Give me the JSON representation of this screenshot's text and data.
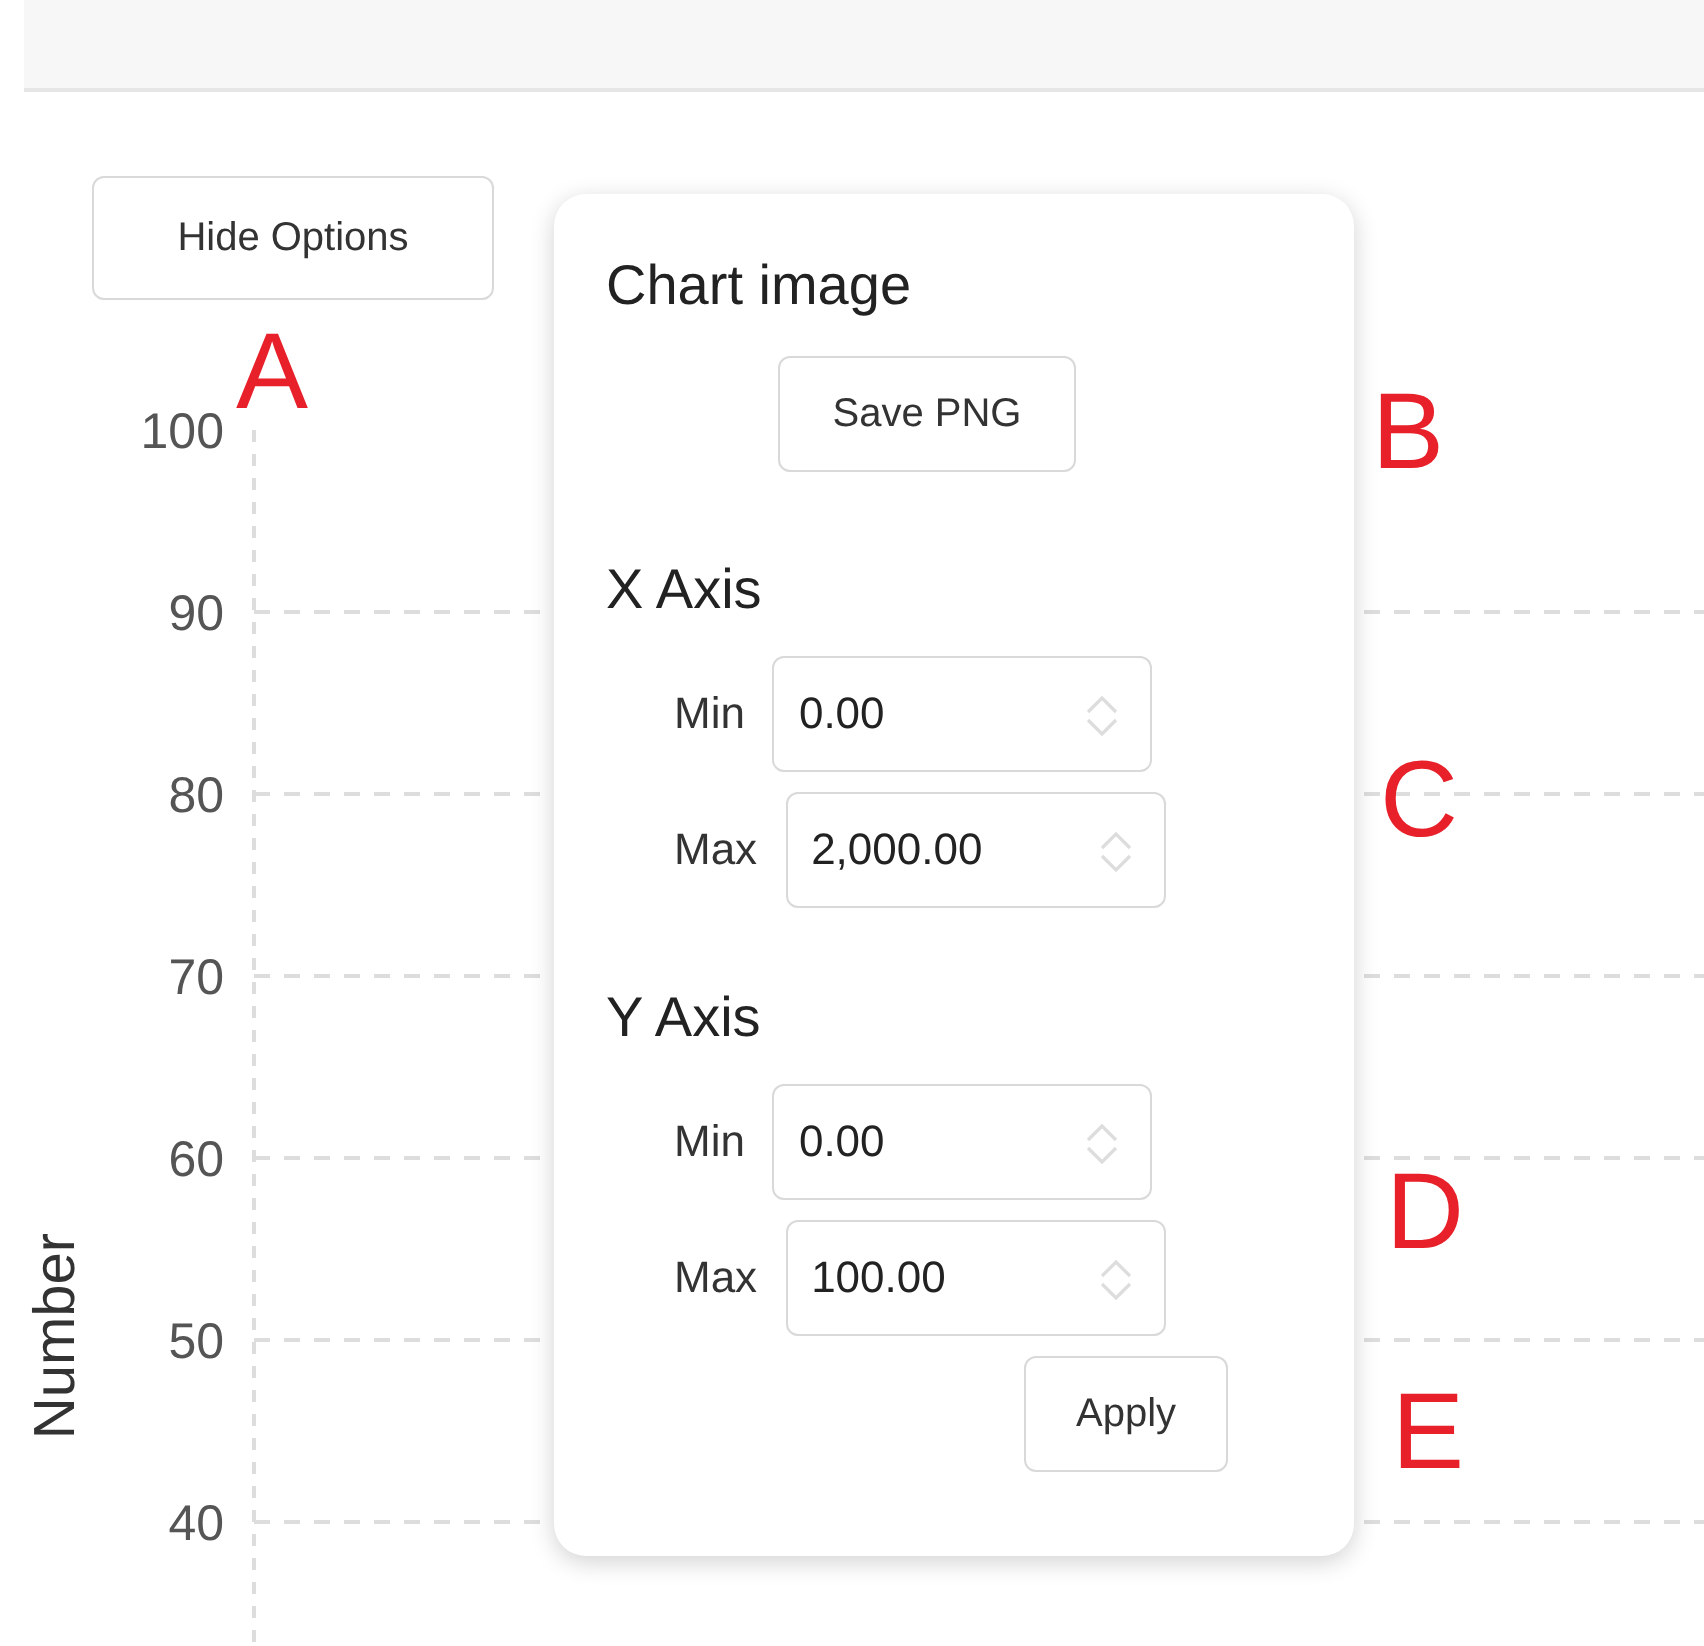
{
  "hide_options_button": "Hide Options",
  "chart": {
    "y_axis": {
      "title": "Number",
      "tick_labels": [
        "100",
        "90",
        "80",
        "70",
        "60",
        "50",
        "40"
      ]
    }
  },
  "options_panel": {
    "title": "Chart image",
    "save_button": "Save PNG",
    "axes": [
      {
        "title": "X Axis",
        "fields": [
          {
            "label": "Min",
            "value": "0.00"
          },
          {
            "label": "Max",
            "value": "2,000.00"
          }
        ]
      },
      {
        "title": "Y Axis",
        "fields": [
          {
            "label": "Min",
            "value": "0.00"
          },
          {
            "label": "Max",
            "value": "100.00"
          }
        ]
      }
    ],
    "apply_button": "Apply"
  },
  "callouts": [
    "A",
    "B",
    "C",
    "D",
    "E"
  ]
}
